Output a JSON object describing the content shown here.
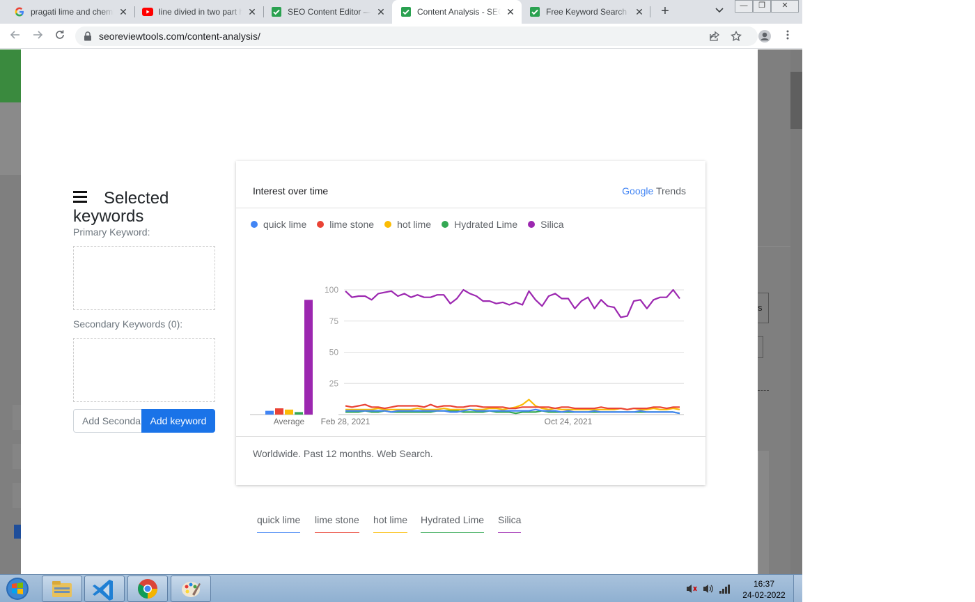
{
  "browser": {
    "tabs": [
      {
        "title": "pragati lime and chemicals",
        "favicon": "google-icon"
      },
      {
        "title": "line divied in two part html",
        "favicon": "youtube-icon"
      },
      {
        "title": "SEO Content Editor — Free",
        "favicon": "seo-review-tools-icon"
      },
      {
        "title": "Content Analysis - SEO",
        "favicon": "seo-review-tools-icon"
      },
      {
        "title": "Free Keyword Search Volume",
        "favicon": "seo-review-tools-icon"
      }
    ],
    "url": "seoreviewtools.com/content-analysis/"
  },
  "keywords_panel": {
    "title": "Selected keywords",
    "primary_label": "Primary Keyword:",
    "secondary_label": "Secondary Keywords (0):",
    "input_placeholder": "Add Secondary",
    "add_button": "Add keyword"
  },
  "trends": {
    "heading": "Interest over time",
    "brand_google": "Google",
    "brand_trends": "Trends",
    "footer": "Worldwide. Past 12 months. Web Search.",
    "average_label": "Average",
    "colors": {
      "quick_lime": "#4285f4",
      "lime_stone": "#ea4335",
      "hot_lime": "#fbbc04",
      "hydrated_lime": "#34a853",
      "silica": "#9c27b0"
    }
  },
  "chart_data": {
    "type": "line",
    "title": "Interest over time",
    "x_tick_labels": [
      "Feb 28, 2021",
      "Oct 24, 2021"
    ],
    "y_ticks": [
      100,
      75,
      50,
      25
    ],
    "ylim": [
      0,
      100
    ],
    "grid": true,
    "legend_position": "top-left",
    "series": [
      {
        "name": "quick lime",
        "color": "#4285f4",
        "average": 3,
        "values": [
          3,
          3,
          3,
          3,
          3,
          3,
          3,
          2,
          3,
          3,
          3,
          3,
          3,
          3,
          3,
          3,
          2,
          2,
          3,
          4,
          3,
          3,
          3,
          3,
          3,
          3,
          3,
          3,
          3,
          4,
          3,
          3,
          3,
          2,
          3,
          2,
          2,
          2,
          3,
          2,
          2,
          2,
          2,
          2,
          2,
          3,
          2,
          2,
          2,
          2,
          2,
          1
        ]
      },
      {
        "name": "lime stone",
        "color": "#ea4335",
        "average": 5,
        "values": [
          7,
          6,
          7,
          8,
          6,
          6,
          5,
          6,
          7,
          7,
          7,
          7,
          6,
          8,
          6,
          7,
          7,
          6,
          6,
          7,
          7,
          6,
          6,
          6,
          6,
          5,
          5,
          6,
          6,
          6,
          6,
          6,
          5,
          6,
          6,
          5,
          5,
          5,
          5,
          6,
          5,
          5,
          5,
          4,
          5,
          5,
          5,
          6,
          6,
          5,
          6,
          6
        ]
      },
      {
        "name": "hot lime",
        "color": "#fbbc04",
        "average": 4,
        "values": [
          4,
          4,
          4,
          4,
          4,
          5,
          4,
          4,
          4,
          4,
          4,
          5,
          4,
          4,
          4,
          5,
          4,
          4,
          4,
          4,
          4,
          4,
          5,
          5,
          4,
          5,
          6,
          8,
          12,
          7,
          5,
          4,
          5,
          4,
          4,
          4,
          4,
          4,
          4,
          4,
          4,
          4,
          5,
          4,
          5,
          4,
          4,
          5,
          4,
          4,
          5,
          4
        ]
      },
      {
        "name": "Hydrated Lime",
        "color": "#34a853",
        "average": 2,
        "values": [
          2,
          2,
          2,
          3,
          2,
          2,
          3,
          2,
          2,
          2,
          2,
          2,
          2,
          2,
          3,
          3,
          3,
          3,
          2,
          2,
          2,
          2,
          3,
          2,
          2,
          2,
          1,
          2,
          2,
          2,
          3,
          2,
          2,
          2,
          2,
          2,
          2,
          2,
          2,
          2,
          2,
          2,
          2,
          2,
          2,
          2,
          2,
          2,
          2,
          2,
          2,
          1
        ]
      },
      {
        "name": "Silica",
        "color": "#9c27b0",
        "average": 92,
        "values": [
          99,
          94,
          95,
          95,
          92,
          97,
          98,
          99,
          95,
          97,
          94,
          96,
          94,
          94,
          96,
          96,
          89,
          93,
          100,
          97,
          95,
          91,
          91,
          89,
          90,
          88,
          90,
          88,
          99,
          92,
          87,
          95,
          97,
          93,
          93,
          85,
          91,
          94,
          85,
          92,
          87,
          86,
          78,
          79,
          91,
          92,
          85,
          92,
          94,
          94,
          100,
          93
        ]
      }
    ]
  },
  "bottom_tabs": [
    "quick lime",
    "lime stone",
    "hot lime",
    "Hydrated Lime",
    "Silica"
  ],
  "taskbar": {
    "time": "16:37",
    "date": "24-02-2022"
  }
}
